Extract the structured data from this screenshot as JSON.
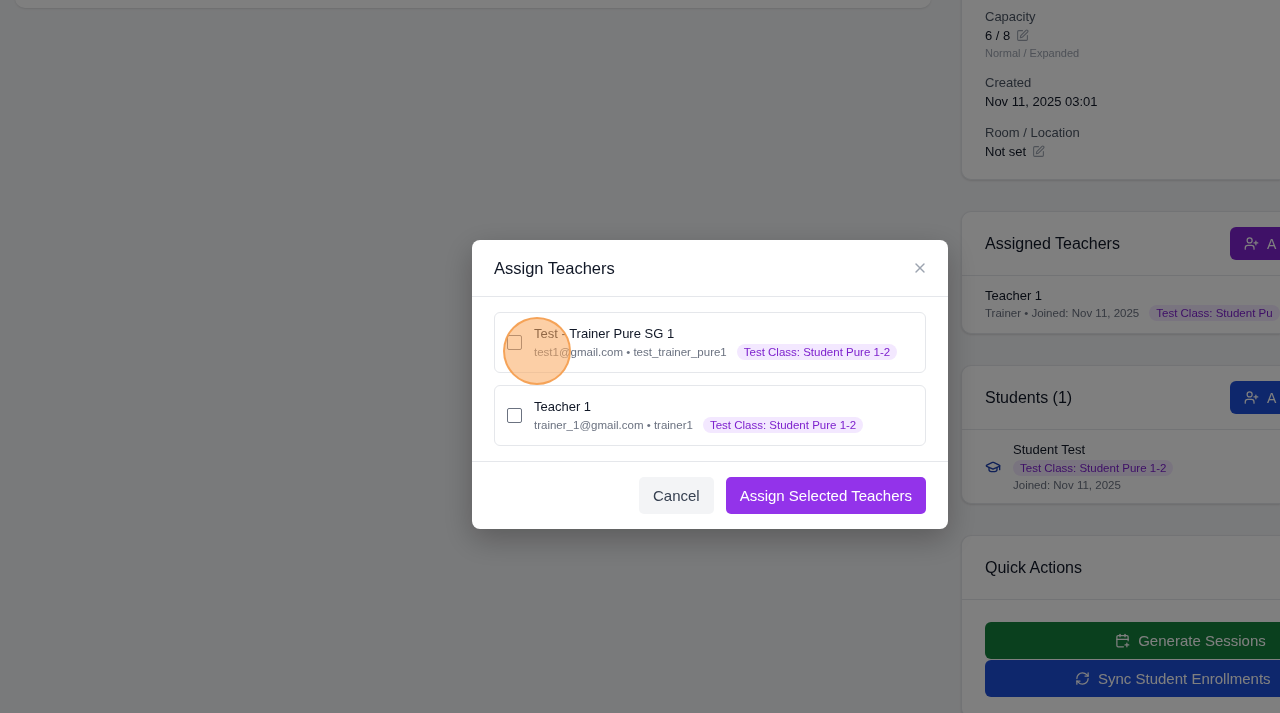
{
  "background": {
    "summary_card": {
      "fields": [
        {
          "label": "Capacity",
          "value": "6 / 8",
          "editable": true,
          "note": "Normal / Expanded"
        },
        {
          "label": "Created",
          "value": "Nov 11, 2025 03:01",
          "editable": false
        },
        {
          "label": "Room / Location",
          "value": "Not set",
          "editable": true
        }
      ]
    },
    "assigned_teachers": {
      "title": "Assigned Teachers",
      "button": "A",
      "kind": "teacher",
      "teachers": [
        {
          "name": "Teacher 1",
          "meta": "Trainer • Joined: Nov 11, 2025",
          "tag": "Test Class: Student Pu"
        }
      ]
    },
    "students": {
      "title": "Students (1)",
      "button": "A",
      "kind": "student",
      "items": [
        {
          "name": "Student Test",
          "tag": "Test Class: Student Pure 1-2",
          "joined": "Joined: Nov 11, 2025"
        }
      ]
    },
    "quick_actions": {
      "title": "Quick Actions",
      "buttons": [
        {
          "label": "Generate Sessions",
          "kind": "generate"
        },
        {
          "label": "Sync Student Enrollments",
          "kind": "sync"
        }
      ]
    }
  },
  "dialog": {
    "title": "Assign Teachers",
    "teachers": [
      {
        "name": "Test - Trainer Pure SG 1",
        "meta": "test1@gmail.com • test_trainer_pure1",
        "tag": "Test Class: Student Pure 1-2",
        "checked": false
      },
      {
        "name": "Teacher 1",
        "meta": "trainer_1@gmail.com • trainer1",
        "tag": "Test Class: Student Pure 1-2",
        "checked": false
      }
    ],
    "buttons": [
      {
        "label": "Cancel",
        "kind": "secondary"
      },
      {
        "label": "Assign Selected Teachers",
        "kind": "primary"
      }
    ]
  }
}
